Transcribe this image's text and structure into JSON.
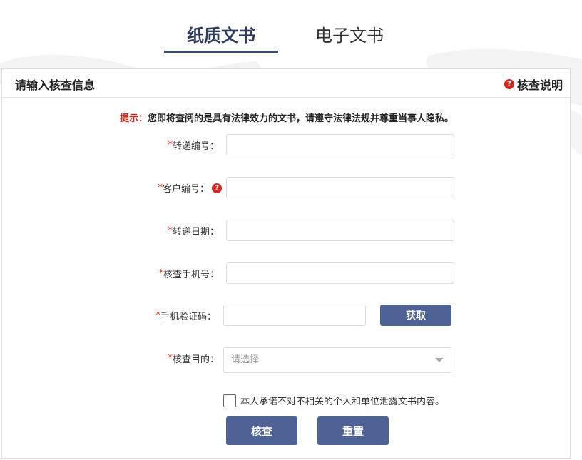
{
  "tabs": [
    {
      "label": "纸质文书",
      "active": true
    },
    {
      "label": "电子文书",
      "active": false
    }
  ],
  "panel": {
    "title": "请输入核查信息",
    "help_label": "核查说明"
  },
  "notice": {
    "label": "提示：",
    "text": "您即将查阅的是具有法律效力的文书，请遵守法律法规并尊重当事人隐私。"
  },
  "form": {
    "required_mark": "*",
    "transfer_no": {
      "label": "转递编号：",
      "value": ""
    },
    "customer_no": {
      "label": "客户编号：",
      "value": ""
    },
    "transfer_date": {
      "label": "转递日期：",
      "value": ""
    },
    "phone": {
      "label": "核查手机号：",
      "value": ""
    },
    "sms_code": {
      "label": "手机验证码：",
      "value": "",
      "get_button": "获取"
    },
    "purpose": {
      "label": "核查目的：",
      "placeholder": "请选择"
    }
  },
  "agreement": {
    "text": "本人承诺不对不相关的个人和单位泄露文书内容。",
    "checked": false
  },
  "buttons": {
    "check": "核查",
    "reset": "重置"
  },
  "colors": {
    "accent": "#4e6296",
    "required": "#d9251c",
    "tab_active": "#2e3b5b"
  },
  "icons": {
    "help": "question-circle-icon"
  }
}
